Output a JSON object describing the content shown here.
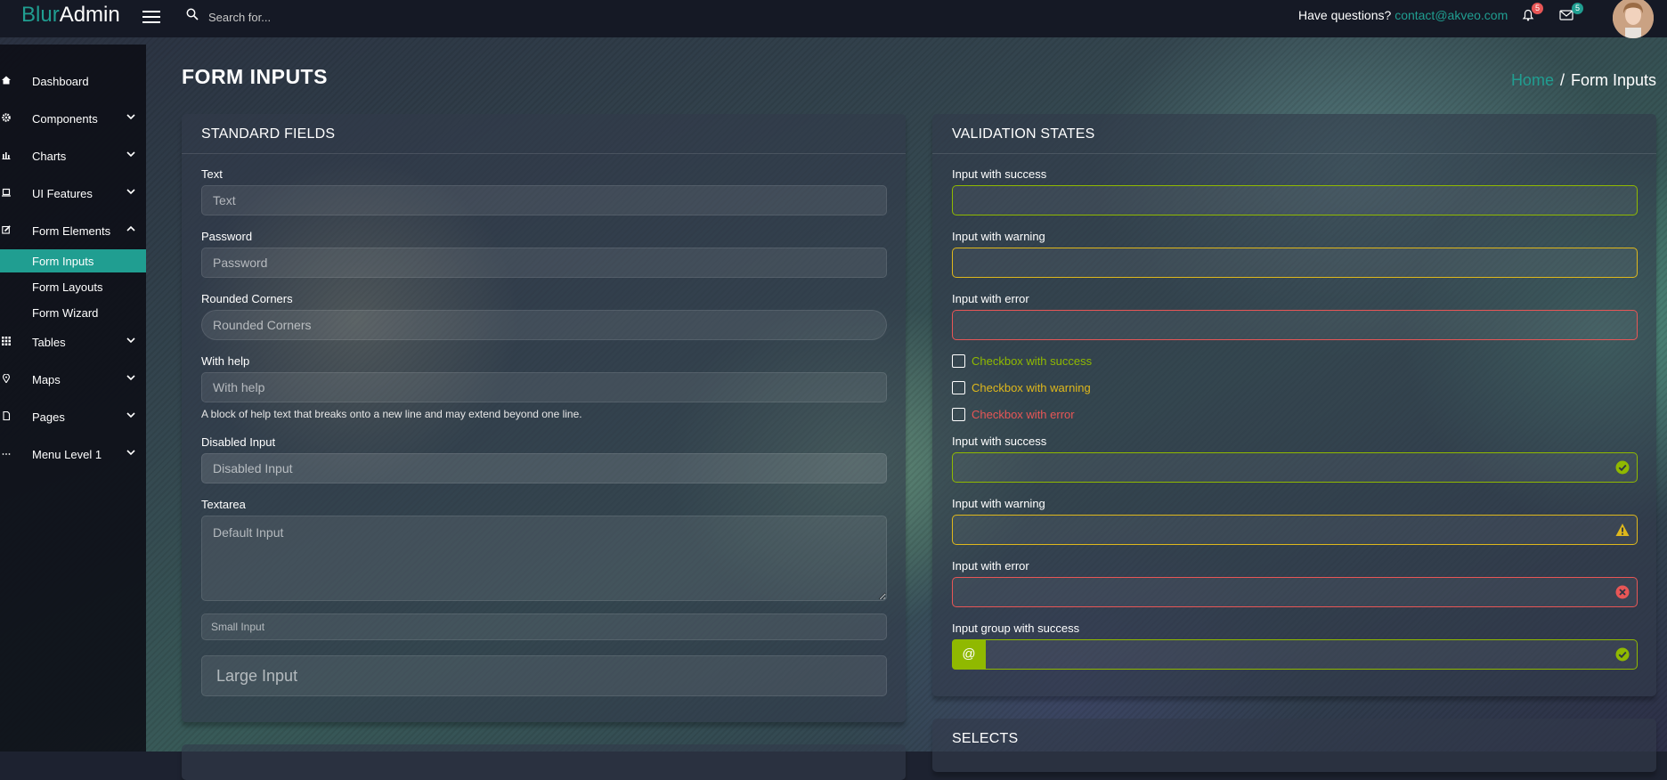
{
  "app": {
    "logo_part1": "Blur",
    "logo_part2": "Admin"
  },
  "header": {
    "search_placeholder": "Search for...",
    "questions_text": "Have questions?",
    "contact_email": "contact@akveo.com",
    "notifications_count": "5",
    "messages_count": "5"
  },
  "sidebar": {
    "items": [
      {
        "label": "Dashboard",
        "icon": "home-icon"
      },
      {
        "label": "Components",
        "icon": "gear-icon"
      },
      {
        "label": "Charts",
        "icon": "bar-chart-icon"
      },
      {
        "label": "UI Features",
        "icon": "laptop-icon"
      },
      {
        "label": "Form Elements",
        "icon": "edit-icon"
      },
      {
        "label": "Tables",
        "icon": "grid-icon"
      },
      {
        "label": "Maps",
        "icon": "map-pin-icon"
      },
      {
        "label": "Pages",
        "icon": "file-icon"
      },
      {
        "label": "Menu Level 1",
        "icon": "more-icon"
      }
    ],
    "form_elements_sub": [
      "Form Inputs",
      "Form Layouts",
      "Form Wizard"
    ],
    "active_sub": "Form Inputs"
  },
  "page": {
    "title": "FORM INPUTS"
  },
  "breadcrumb": {
    "home": "Home",
    "separator": "/",
    "current": "Form Inputs"
  },
  "standard_fields": {
    "title": "STANDARD FIELDS",
    "text_label": "Text",
    "text_placeholder": "Text",
    "password_label": "Password",
    "password_placeholder": "Password",
    "rounded_label": "Rounded Corners",
    "rounded_placeholder": "Rounded Corners",
    "help_label": "With help",
    "help_placeholder": "With help",
    "help_text": "A block of help text that breaks onto a new line and may extend beyond one line.",
    "disabled_label": "Disabled Input",
    "disabled_placeholder": "Disabled Input",
    "textarea_label": "Textarea",
    "textarea_placeholder": "Default Input",
    "small_placeholder": "Small Input",
    "large_placeholder": "Large Input"
  },
  "validation": {
    "title": "VALIDATION STATES",
    "success_label": "Input with success",
    "warning_label": "Input with warning",
    "error_label": "Input with error",
    "cb_success": "Checkbox with success",
    "cb_warning": "Checkbox with warning",
    "cb_error": "Checkbox with error",
    "group_success_label": "Input group with success",
    "addon": "@"
  },
  "selects": {
    "title": "SELECTS"
  },
  "colors": {
    "accent": "#209e91",
    "success": "#90b900",
    "warning": "#dfb81c",
    "danger": "#e85656"
  }
}
